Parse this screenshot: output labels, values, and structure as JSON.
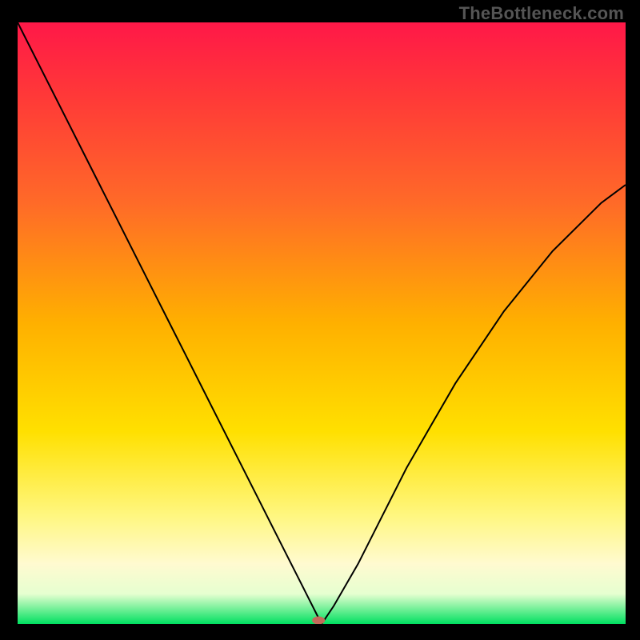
{
  "watermark": "TheBottleneck.com",
  "chart_data": {
    "type": "line",
    "title": "",
    "xlabel": "",
    "ylabel": "",
    "xlim": [
      0,
      100
    ],
    "ylim": [
      0,
      100
    ],
    "grid": false,
    "background_gradient": {
      "stops": [
        {
          "offset": 0.0,
          "color": "#ff1848"
        },
        {
          "offset": 0.12,
          "color": "#ff3838"
        },
        {
          "offset": 0.3,
          "color": "#ff6a28"
        },
        {
          "offset": 0.5,
          "color": "#ffb000"
        },
        {
          "offset": 0.68,
          "color": "#ffe000"
        },
        {
          "offset": 0.82,
          "color": "#fff780"
        },
        {
          "offset": 0.9,
          "color": "#fffad0"
        },
        {
          "offset": 0.95,
          "color": "#e6ffd0"
        },
        {
          "offset": 1.0,
          "color": "#00e060"
        }
      ]
    },
    "series": [
      {
        "name": "bottleneck-curve",
        "color": "#000000",
        "width": 2,
        "x": [
          0,
          4,
          8,
          12,
          16,
          20,
          24,
          28,
          32,
          36,
          40,
          44,
          46,
          48,
          49,
          49.5,
          50,
          52,
          56,
          60,
          64,
          68,
          72,
          76,
          80,
          84,
          88,
          92,
          96,
          100
        ],
        "y": [
          100,
          92,
          84,
          76,
          68,
          60,
          52,
          44,
          36,
          28,
          20,
          12,
          8,
          4,
          2,
          1,
          0,
          3,
          10,
          18,
          26,
          33,
          40,
          46,
          52,
          57,
          62,
          66,
          70,
          73
        ]
      }
    ],
    "markers": [
      {
        "name": "optimal-point",
        "x": 49.5,
        "y": 0.6,
        "color": "#c46a5a",
        "rx": 8,
        "ry": 5
      }
    ]
  }
}
